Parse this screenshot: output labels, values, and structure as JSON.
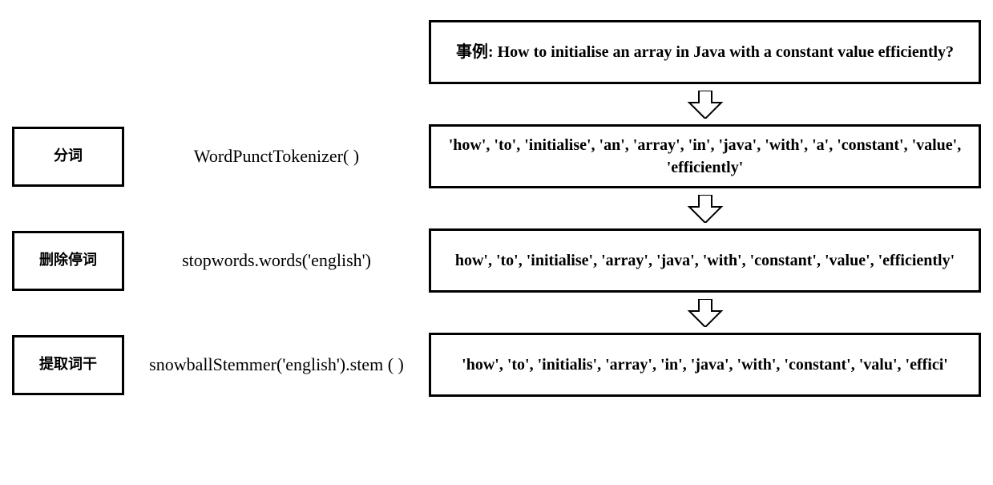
{
  "diagram": {
    "example_prefix": "事例:",
    "example_text": "How to initialise an array in Java with a constant value efficiently?",
    "steps": [
      {
        "label": "分词",
        "code": "WordPunctTokenizer( )",
        "output": "'how', 'to', 'initialise', 'an', 'array', 'in', 'java', 'with', 'a', 'constant', 'value', 'efficiently'"
      },
      {
        "label": "删除停词",
        "code": "stopwords.words('english')",
        "output": "how', 'to', 'initialise', 'array', 'java', 'with', 'constant', 'value', 'efficiently'"
      },
      {
        "label": "提取词干",
        "code": "snowballStemmer('english').stem ( )",
        "output": "'how', 'to', 'initialis', 'array', 'in', 'java', 'with', 'constant', 'valu', 'effici'"
      }
    ]
  }
}
